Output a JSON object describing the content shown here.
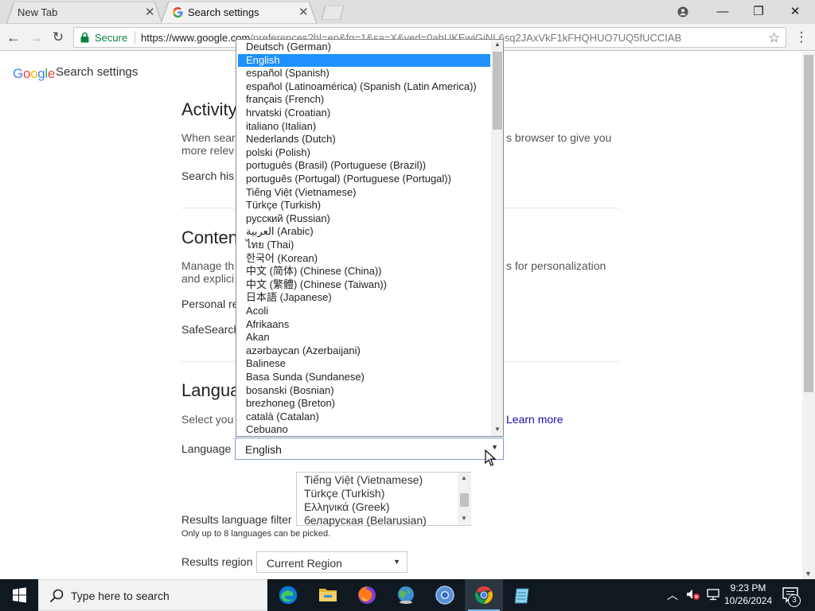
{
  "browser": {
    "tabs": [
      {
        "title": "New Tab",
        "active": false
      },
      {
        "title": "Search settings",
        "active": true
      }
    ],
    "address_bar": {
      "secure_label": "Secure",
      "url_host": "https://www.google.com",
      "url_path": "/preferences?hl=en&fg=1&sa=X&ved=0ahUKEwiGiNL6sq2JAxVkF1kFHQHUO7UQ5fUCCIAB"
    }
  },
  "page": {
    "logo_text": [
      "G",
      "o",
      "o",
      "g",
      "l",
      "e"
    ],
    "settings_title": "Search settings",
    "activity": {
      "heading": "Activity",
      "desc_left_1": "When sear",
      "desc_right_1": "s browser to give you",
      "desc_left_2": "more relev",
      "row_label": "Search his"
    },
    "content": {
      "heading": "Conten",
      "desc_left_1": "Manage th",
      "desc_right_1": "s for personalization",
      "desc_left_2": "and explici",
      "row_1": "Personal re",
      "row_2": "SafeSearch"
    },
    "language": {
      "heading": "Langua",
      "desc_left": "Select you",
      "learn_more": "Learn more",
      "label": "Language",
      "selected": "English"
    },
    "results_filter": {
      "label": "Results language filter",
      "items": [
        "Tiếng Việt (Vietnamese)",
        "Türkçe (Turkish)",
        "Ελληνικά (Greek)",
        "беларуская (Belarusian)"
      ],
      "note": "Only up to 8 languages can be picked."
    },
    "results_region": {
      "label": "Results region",
      "value": "Current Region"
    }
  },
  "dropdown": {
    "selected_index": 1,
    "options": [
      "Deutsch (German)",
      "English",
      "español (Spanish)",
      "español (Latinoamérica) (Spanish (Latin America))",
      "français (French)",
      "hrvatski (Croatian)",
      "italiano (Italian)",
      "Nederlands (Dutch)",
      "polski (Polish)",
      "português (Brasil) (Portuguese (Brazil))",
      "português (Portugal) (Portuguese (Portugal))",
      "Tiếng Việt (Vietnamese)",
      "Türkçe (Turkish)",
      "русский (Russian)",
      "العربية (Arabic)",
      "ไทย (Thai)",
      "한국어 (Korean)",
      "中文 (简体) (Chinese (China))",
      "中文 (繁體) (Chinese (Taiwan))",
      "日本語 (Japanese)",
      "Acoli",
      "Afrikaans",
      "Akan",
      "azərbaycan (Azerbaijani)",
      "Balinese",
      "Basa Sunda (Sundanese)",
      "bosanski (Bosnian)",
      "brezhoneg (Breton)",
      "català (Catalan)",
      "Cebuano"
    ]
  },
  "taskbar": {
    "search_placeholder": "Type here to search",
    "apps": [
      "edge-icon",
      "file-explorer-icon",
      "firefox-icon",
      "network-globe-icon",
      "chromium-icon",
      "chrome-icon",
      "notepad-icon"
    ],
    "clock_time": "9:23 PM",
    "clock_date": "10/26/2024",
    "notification_count": "3"
  },
  "colors": {
    "selected_option": "#1e90ff",
    "secure_green": "#0b8043",
    "link_blue": "#1a0dab",
    "taskbar_bg": "#101820"
  }
}
